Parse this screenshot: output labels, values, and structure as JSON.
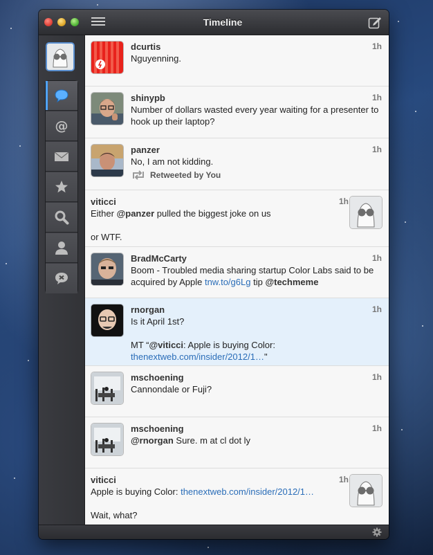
{
  "window": {
    "title": "Timeline"
  },
  "sidebar": {
    "nav": [
      {
        "name": "timeline",
        "icon": "speech-bubble-icon",
        "active": true
      },
      {
        "name": "mentions",
        "icon": "at-icon",
        "active": false
      },
      {
        "name": "messages",
        "icon": "envelope-icon",
        "active": false
      },
      {
        "name": "favorites",
        "icon": "star-icon",
        "active": false
      },
      {
        "name": "search",
        "icon": "magnifier-icon",
        "active": false
      },
      {
        "name": "profile",
        "icon": "person-icon",
        "active": false
      },
      {
        "name": "mute",
        "icon": "mute-bubble-icon",
        "active": false
      }
    ]
  },
  "tweets": [
    {
      "user": "dcurtis",
      "time": "1h",
      "text_parts": [
        {
          "t": "Nguyenning."
        }
      ]
    },
    {
      "user": "shinypb",
      "time": "1h",
      "text_parts": [
        {
          "t": "Number of dollars wasted every year waiting for a presenter to hook up their laptop?"
        }
      ]
    },
    {
      "user": "panzer",
      "time": "1h",
      "text_parts": [
        {
          "t": "No, I am not kidding."
        }
      ],
      "retweet_label": "Retweeted by You"
    },
    {
      "user": "viticci",
      "time": "1h",
      "text_parts": [
        {
          "t": "Either "
        },
        {
          "t": "@panzer",
          "kind": "mention"
        },
        {
          "t": " pulled the biggest joke on us"
        },
        {
          "t": "\n\nor WTF."
        }
      ]
    },
    {
      "user": "BradMcCarty",
      "time": "1h",
      "text_parts": [
        {
          "t": "Boom - Troubled media sharing startup Color Labs said to be acquired by Apple "
        },
        {
          "t": "tnw.to/g6Lg",
          "kind": "link"
        },
        {
          "t": " tip "
        },
        {
          "t": "@techmeme",
          "kind": "mention"
        }
      ]
    },
    {
      "user": "rnorgan",
      "time": "1h",
      "text_parts": [
        {
          "t": "Is it April 1st?\n\nMT “"
        },
        {
          "t": "@viticci",
          "kind": "mention"
        },
        {
          "t": ": Apple is buying Color: "
        },
        {
          "t": "thenextweb.com/insider/2012/1…",
          "kind": "link"
        },
        {
          "t": "\""
        }
      ]
    },
    {
      "user": "mschoening",
      "time": "1h",
      "text_parts": [
        {
          "t": "Cannondale or Fuji?"
        }
      ]
    },
    {
      "user": "mschoening",
      "time": "1h",
      "text_parts": [
        {
          "t": "@rnorgan",
          "kind": "mention"
        },
        {
          "t": " Sure. m at cl dot ly"
        }
      ]
    },
    {
      "user": "viticci",
      "time": "1h",
      "text_parts": [
        {
          "t": "Apple is buying Color: "
        },
        {
          "t": "thenextweb.com/insider/2012/1…",
          "kind": "link"
        },
        {
          "t": "\n\nWait, what?"
        }
      ]
    }
  ],
  "colors": {
    "accent": "#4fa3ff",
    "link": "#2a6db8",
    "highlight_row": "#e4f0fb"
  }
}
